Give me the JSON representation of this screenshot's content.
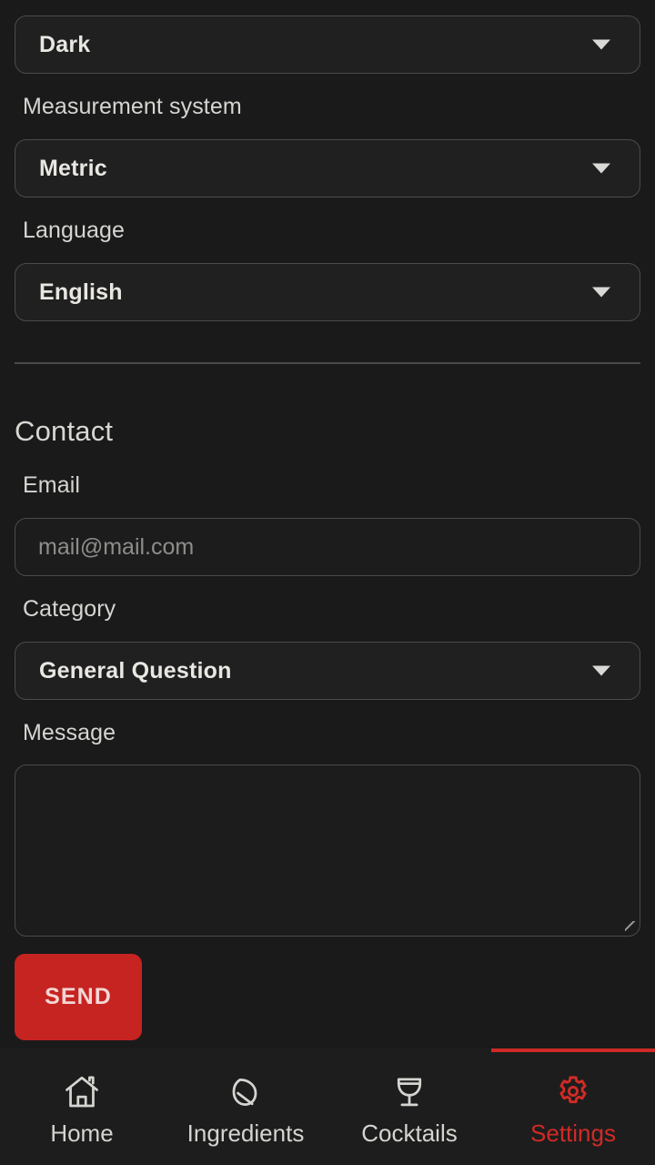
{
  "settings": {
    "theme": {
      "selected": "Dark",
      "caret_icon": "chevron-down-icon"
    },
    "measurement": {
      "label": "Measurement system",
      "selected": "Metric",
      "caret_icon": "chevron-down-icon"
    },
    "language": {
      "label": "Language",
      "selected": "English",
      "caret_icon": "chevron-down-icon"
    }
  },
  "contact": {
    "heading": "Contact",
    "email": {
      "label": "Email",
      "value": "",
      "placeholder": "mail@mail.com"
    },
    "category": {
      "label": "Category",
      "selected": "General Question",
      "caret_icon": "chevron-down-icon"
    },
    "message": {
      "label": "Message",
      "value": "",
      "placeholder": ""
    },
    "send_label": "SEND"
  },
  "bottom_nav": {
    "items": [
      {
        "label": "Home",
        "icon": "home-icon",
        "active": false
      },
      {
        "label": "Ingredients",
        "icon": "leaf-icon",
        "active": false
      },
      {
        "label": "Cocktails",
        "icon": "cocktail-glass-icon",
        "active": false
      },
      {
        "label": "Settings",
        "icon": "gear-icon",
        "active": true
      }
    ]
  },
  "colors": {
    "background": "#1a1a1a",
    "surface": "#202020",
    "border": "#4b4b4b",
    "text": "#d8d8d4",
    "placeholder": "#8d8d8a",
    "accent": "#c52421",
    "accent_active": "#cf2b26"
  }
}
